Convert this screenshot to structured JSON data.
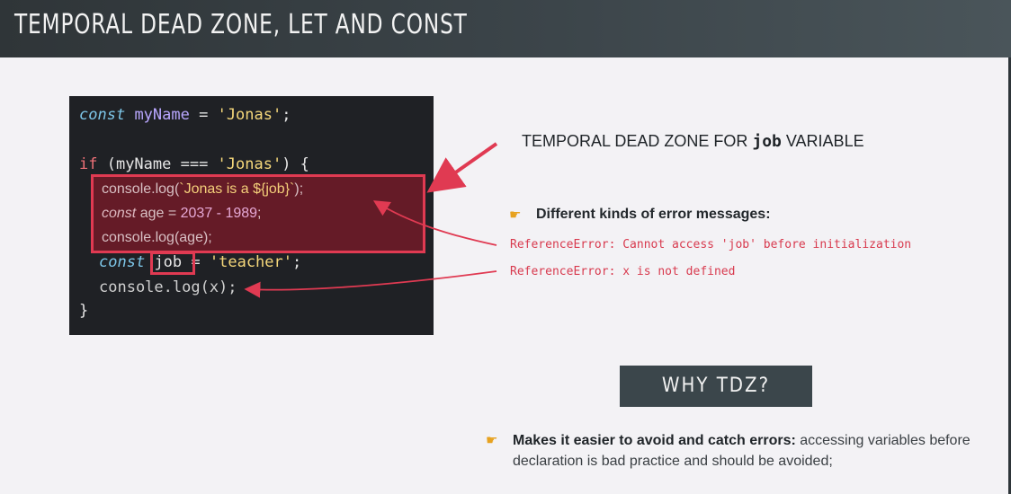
{
  "header": {
    "title": "TEMPORAL DEAD ZONE, LET AND CONST"
  },
  "code": {
    "line1": {
      "kw": "const",
      "var": "myName",
      "op": " = ",
      "str": "'Jonas'",
      "end": ";"
    },
    "line2": {
      "kw": "if",
      "open": " (myName === ",
      "str": "'Jonas'",
      "close": ") {"
    },
    "line3": {
      "fn": "console.log(",
      "str": "`Jonas is a ${job}`",
      "end": ");"
    },
    "line4": {
      "kw": "const",
      "var": " age = ",
      "num": "2037 - 1989",
      "end": ";"
    },
    "line5": {
      "fn": "console.log(age);"
    },
    "line6": {
      "kw": "const",
      "job": "job",
      "eq": " = ",
      "str": "'teacher'",
      "end": ";"
    },
    "line7": {
      "fn": "console.log(x);"
    },
    "line8": {
      "close": "}"
    }
  },
  "tdz_label": {
    "prefix": "TEMPORAL DEAD ZONE FOR ",
    "code": "job",
    "suffix": " VARIABLE"
  },
  "errors": {
    "heading": "Different kinds of error messages:",
    "messages": [
      "ReferenceError: Cannot access 'job' before initialization",
      "ReferenceError: x is not defined"
    ]
  },
  "why": {
    "button_label": "WHY TDZ?",
    "bold": "Makes it easier to avoid and catch errors:",
    "text": " accessing variables before declaration is bad practice and should be avoided;"
  },
  "icons": {
    "bullet": "pointing-hand-icon"
  },
  "colors": {
    "accent_red": "#e03a52",
    "bullet_orange": "#e7a21f",
    "header_bg": "#3c454a"
  }
}
